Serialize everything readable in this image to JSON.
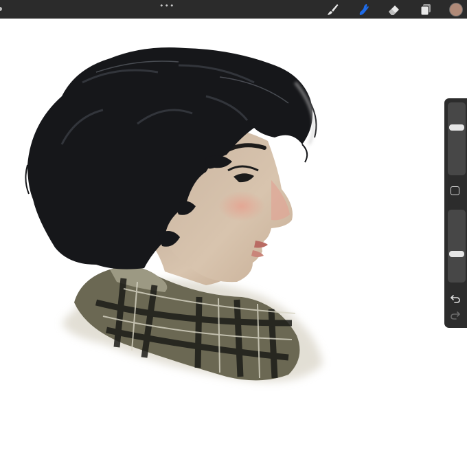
{
  "toolbar": {
    "more_menu": "•••",
    "tools": [
      {
        "name": "brush-icon",
        "active": false
      },
      {
        "name": "smudge-icon",
        "active": true
      },
      {
        "name": "eraser-icon",
        "active": false
      },
      {
        "name": "layers-icon",
        "active": false
      }
    ],
    "active_tool_color": "#1e6be8",
    "current_color": "#b08a78"
  },
  "sidebar": {
    "brush_size_level": 0.67,
    "brush_opacity_level": 0.38,
    "modify_icon": "square-icon",
    "undo_icon": "undo-arrow-icon",
    "redo_icon": "redo-arrow-icon",
    "redo_enabled": false
  },
  "canvas": {
    "background": "#ffffff",
    "artwork": "portrait-painting"
  }
}
